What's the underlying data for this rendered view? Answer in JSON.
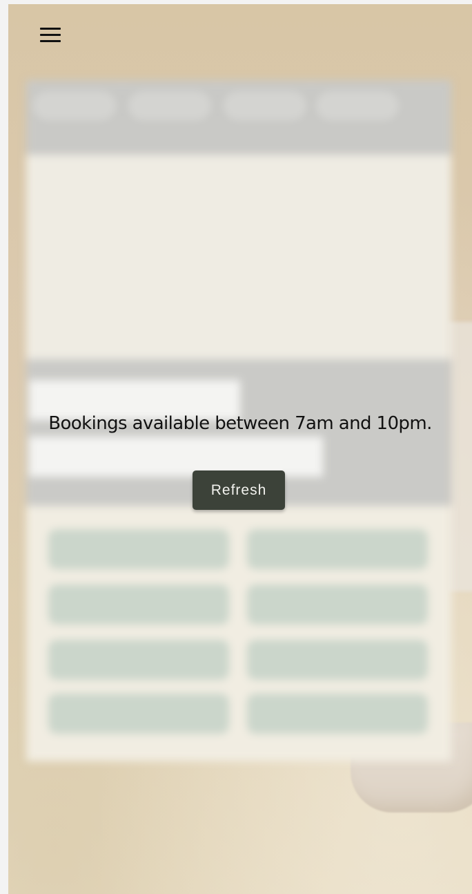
{
  "header": {
    "menu_icon": "hamburger-menu-icon"
  },
  "notice": {
    "message": "Bookings available between 7am and 10pm.",
    "refresh_label": "Refresh"
  },
  "colors": {
    "button_background": "#3c4239",
    "button_text": "#f2f2ee",
    "background_tan": "#d8c6a6",
    "slot_green": "#cbd6cb"
  }
}
